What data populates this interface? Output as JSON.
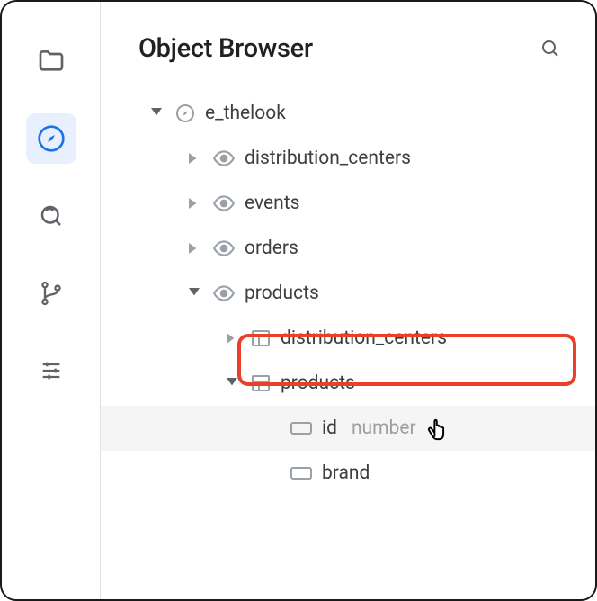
{
  "panelTitle": "Object Browser",
  "tree": {
    "root": {
      "label": "e_thelook",
      "children": {
        "distribution_centers": {
          "label": "distribution_centers"
        },
        "events": {
          "label": "events"
        },
        "orders": {
          "label": "orders"
        },
        "products": {
          "label": "products",
          "children": {
            "distribution_centers_table": {
              "label": "distribution_centers"
            },
            "products_table": {
              "label": "products",
              "fields": {
                "id": {
                  "label": "id",
                  "type": "number"
                },
                "brand": {
                  "label": "brand"
                }
              }
            }
          }
        }
      }
    }
  }
}
